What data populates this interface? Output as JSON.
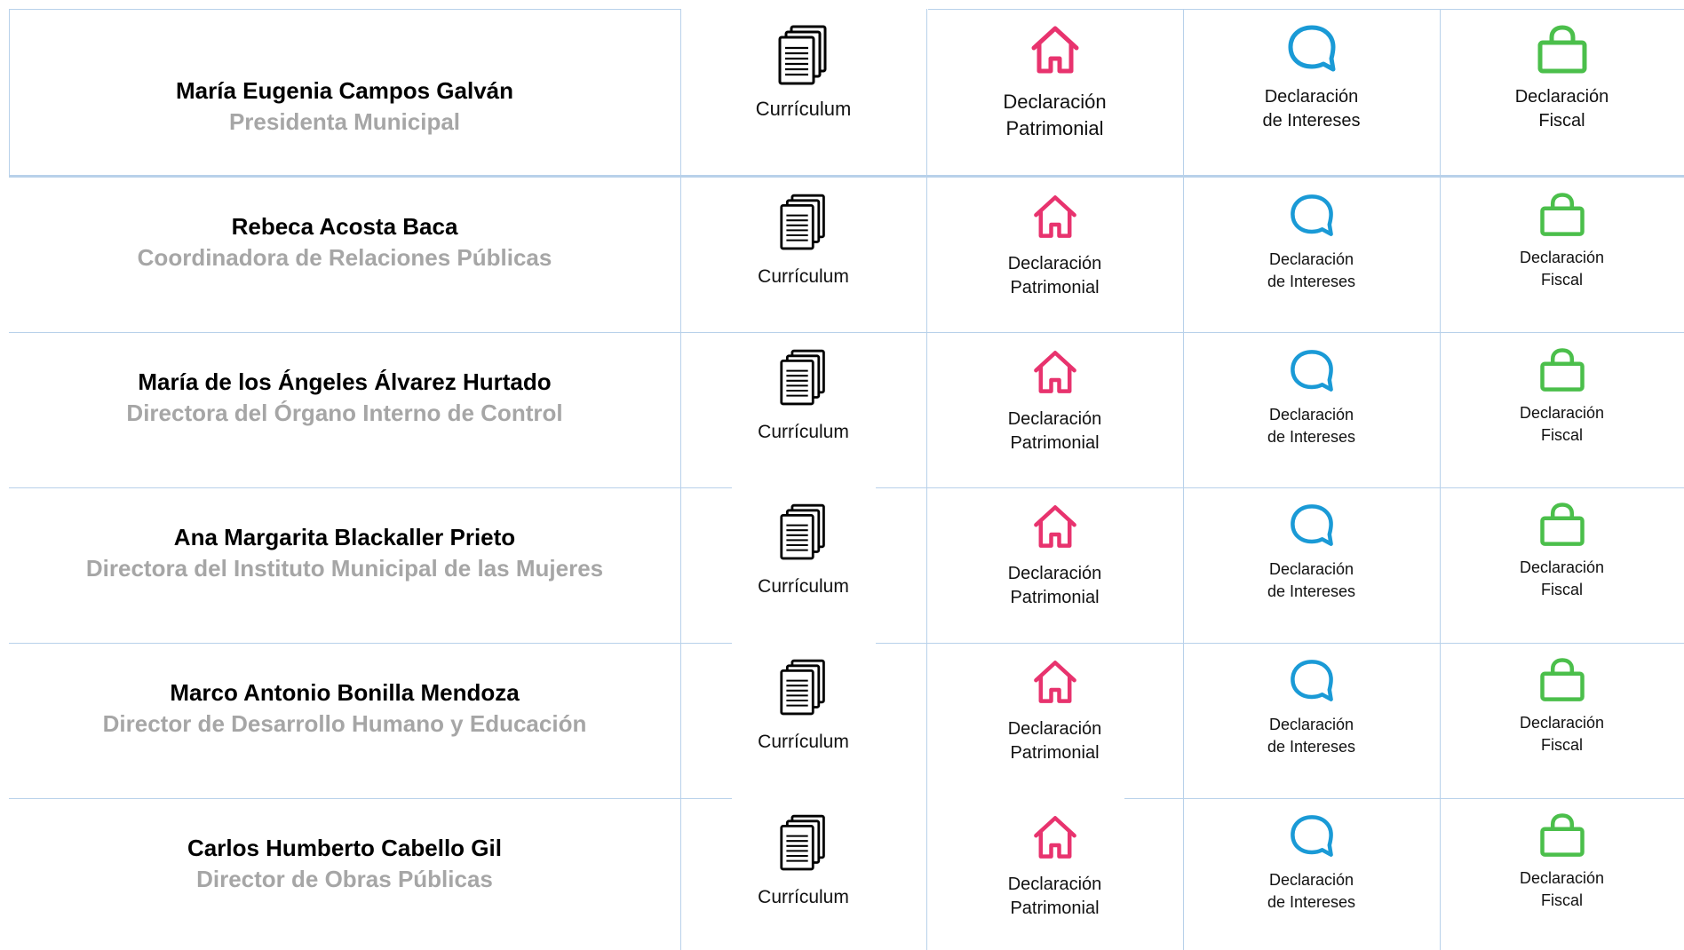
{
  "columns": {
    "curriculum": "Currículum",
    "patrimonial": [
      "Declaración",
      "Patrimonial"
    ],
    "intereses": [
      "Declaración",
      "de Intereses"
    ],
    "fiscal": [
      "Declaración",
      "Fiscal"
    ]
  },
  "icons": {
    "curriculum": "documents-stack-icon",
    "patrimonial": "house-icon",
    "intereses": "speech-bubble-icon",
    "fiscal": "shopping-bag-icon"
  },
  "colors": {
    "patrimonial": "#e8336e",
    "intereses": "#1a9ad6",
    "fiscal": "#4bbf4b",
    "curriculum": "#000000",
    "role": "#a6a6a6",
    "grid": "#b8d1ea"
  },
  "people": [
    {
      "name": "María Eugenia Campos Galván",
      "role": "Presidenta Municipal"
    },
    {
      "name": "Rebeca Acosta Baca",
      "role": "Coordinadora de Relaciones Públicas"
    },
    {
      "name": "María de los Ángeles Álvarez Hurtado",
      "role": "Directora del Órgano Interno de Control"
    },
    {
      "name": "Ana Margarita Blackaller Prieto",
      "role": "Directora del Instituto Municipal de las Mujeres"
    },
    {
      "name": "Marco Antonio Bonilla Mendoza",
      "role": "Director de Desarrollo Humano y Educación"
    },
    {
      "name": "Carlos Humberto Cabello Gil",
      "role": "Director de Obras Públicas"
    }
  ]
}
